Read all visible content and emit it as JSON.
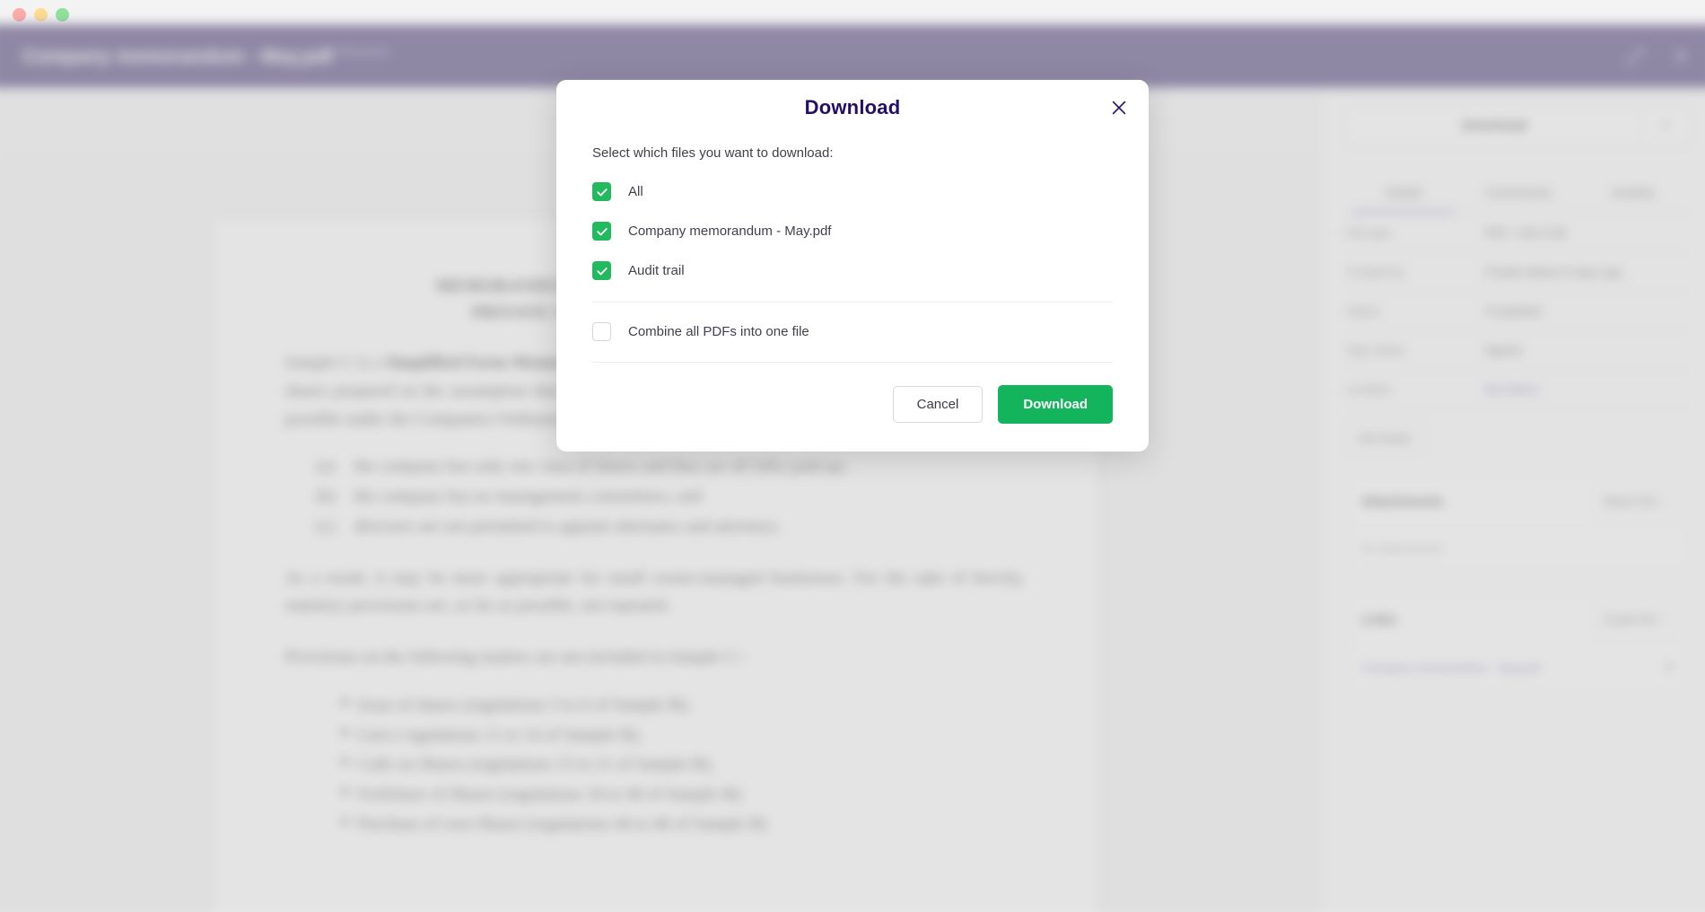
{
  "window": {
    "traffic_lights": [
      "close",
      "minimize",
      "maximize"
    ]
  },
  "header": {
    "title": "Company memorandum - May.pdf",
    "rename_label": "[Rename]",
    "expand_icon": "expand-icon",
    "close_icon": "close-icon"
  },
  "viewer": {
    "document": {
      "heading_line1": "MEMORANDUM AND ARTICLES OF ASSOCIATION",
      "heading_line2": "PRIVATE COMPANY LIMITED BY SHARES",
      "paragraph1_lead": "Sample C is a ",
      "paragraph1_bold": "Simplified Form Memorandum & Articles of Association",
      "paragraph1_rest": " for private company limited by shares prepared on the assumption that the company adopting it will simplify its administration as far as possible under the Companies Ordinance (Cap 32).    For example,",
      "clauses": [
        {
          "marker": "(a)",
          "text": "the company has only one class of shares and they are all fully paid-up;"
        },
        {
          "marker": "(b)",
          "text": "the company has no management committees; and"
        },
        {
          "marker": "(c)",
          "text": "directors are not permitted to appoint alternates and attorneys."
        }
      ],
      "paragraph2": "As a result, it may be more appropriate for small owner-managed businesses.   For the sake of brevity, statutory provisions are, as far as possible, not repeated.",
      "provisions_intro": "Provisions on the following matters are not included in Sample C:-",
      "provisions": [
        "Issue of shares (regulations 3 to 6 of Sample B);",
        "Lien ( regulations 11 to 14 of Sample B);",
        "Calls on Shares (regulations 15 to 21 of Sample B);",
        "Forfeiture of Shares (regulations 34 to 40 of Sample B);",
        "Purchase of own Shares (regulations 44 to 46 of Sample B)"
      ],
      "bullet_glyph": "➤"
    }
  },
  "sidebar": {
    "download_button": "Download",
    "download_caret_icon": "chevron-down-icon",
    "tabs": [
      {
        "label": "Detail",
        "active": true
      },
      {
        "label": "Comments",
        "active": false
      },
      {
        "label": "Activity",
        "active": false
      }
    ],
    "details": [
      {
        "key": "File type",
        "value": "PDF / 194.3 KB",
        "is_link": false
      },
      {
        "key": "Created by",
        "value": "Charlie Adams 6 days ago",
        "is_link": false
      },
      {
        "key": "Status",
        "value": "Completed",
        "is_link": false
      },
      {
        "key": "Sign status",
        "value": "Signed",
        "is_link": false
      },
      {
        "key": "Location",
        "value": "My folders",
        "is_link": true
      }
    ],
    "edit_details_button": "Edit details",
    "attachments": {
      "title": "Attachments",
      "action_label": "Attach File  +",
      "empty_text": "No attachments"
    },
    "links": {
      "title": "Links",
      "action_label": "Create link  +",
      "items": [
        {
          "label": "Company memorandum - May.pdf",
          "remove_icon": "✕"
        }
      ]
    }
  },
  "modal": {
    "title": "Download",
    "close_icon": "close-icon",
    "subtitle": "Select which files you want to download:",
    "file_options": [
      {
        "label": "All",
        "checked": true
      },
      {
        "label": "Company memorandum - May.pdf",
        "checked": true
      },
      {
        "label": "Audit trail",
        "checked": true
      }
    ],
    "combine_option": {
      "label": "Combine all PDFs into one file",
      "checked": false
    },
    "cancel_label": "Cancel",
    "confirm_label": "Download"
  },
  "colors": {
    "brand_purple": "#3a1b9a",
    "title_navy": "#231065",
    "accent_green": "#13b45c",
    "checkbox_green": "#22b95f",
    "link_purple": "#6b46d6",
    "tab_underline": "#9b7de8"
  }
}
